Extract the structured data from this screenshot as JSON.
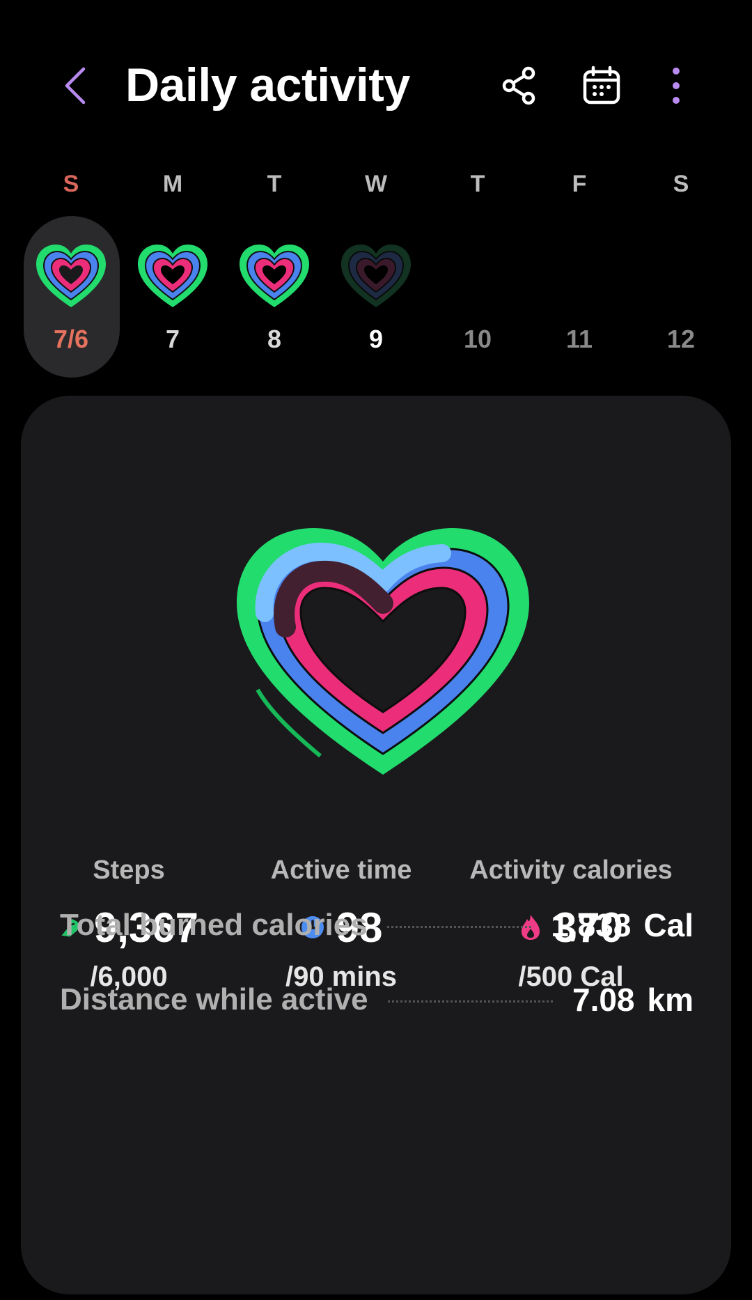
{
  "header": {
    "title": "Daily activity",
    "back_icon": "chevron-left-icon",
    "share_icon": "share-icon",
    "calendar_icon": "calendar-icon",
    "more_icon": "more-vert-icon",
    "accent": "#b98bf0"
  },
  "week": {
    "days": [
      {
        "dow": "S",
        "date": "7/6"
      },
      {
        "dow": "M",
        "date": "7"
      },
      {
        "dow": "T",
        "date": "8"
      },
      {
        "dow": "W",
        "date": "9"
      },
      {
        "dow": "T",
        "date": "10"
      },
      {
        "dow": "F",
        "date": "11"
      },
      {
        "dow": "S",
        "date": "12"
      }
    ],
    "selected_index": 0
  },
  "stats": {
    "steps": {
      "label": "Steps",
      "value": "9,367",
      "goal": "/6,000",
      "icon": "shoe-icon",
      "color": "#22c468"
    },
    "active_time": {
      "label": "Active time",
      "value": "98",
      "goal": "/90 mins",
      "icon": "clock-icon",
      "color": "#4d8cf0"
    },
    "activity_calories": {
      "label": "Activity calories",
      "value": "370",
      "goal": "/500 Cal",
      "icon": "flame-icon",
      "color": "#f03c86"
    }
  },
  "summary": {
    "total_burned": {
      "label": "Total burned calories",
      "value": "1,838",
      "unit": "Cal"
    },
    "distance": {
      "label": "Distance while active",
      "value": "7.08",
      "unit": "km"
    }
  },
  "colors": {
    "green": "#22dc6e",
    "blue": "#4a82ee",
    "light_blue": "#7cc0ff",
    "pink": "#ec2e7a",
    "card": "#1a1a1c"
  }
}
